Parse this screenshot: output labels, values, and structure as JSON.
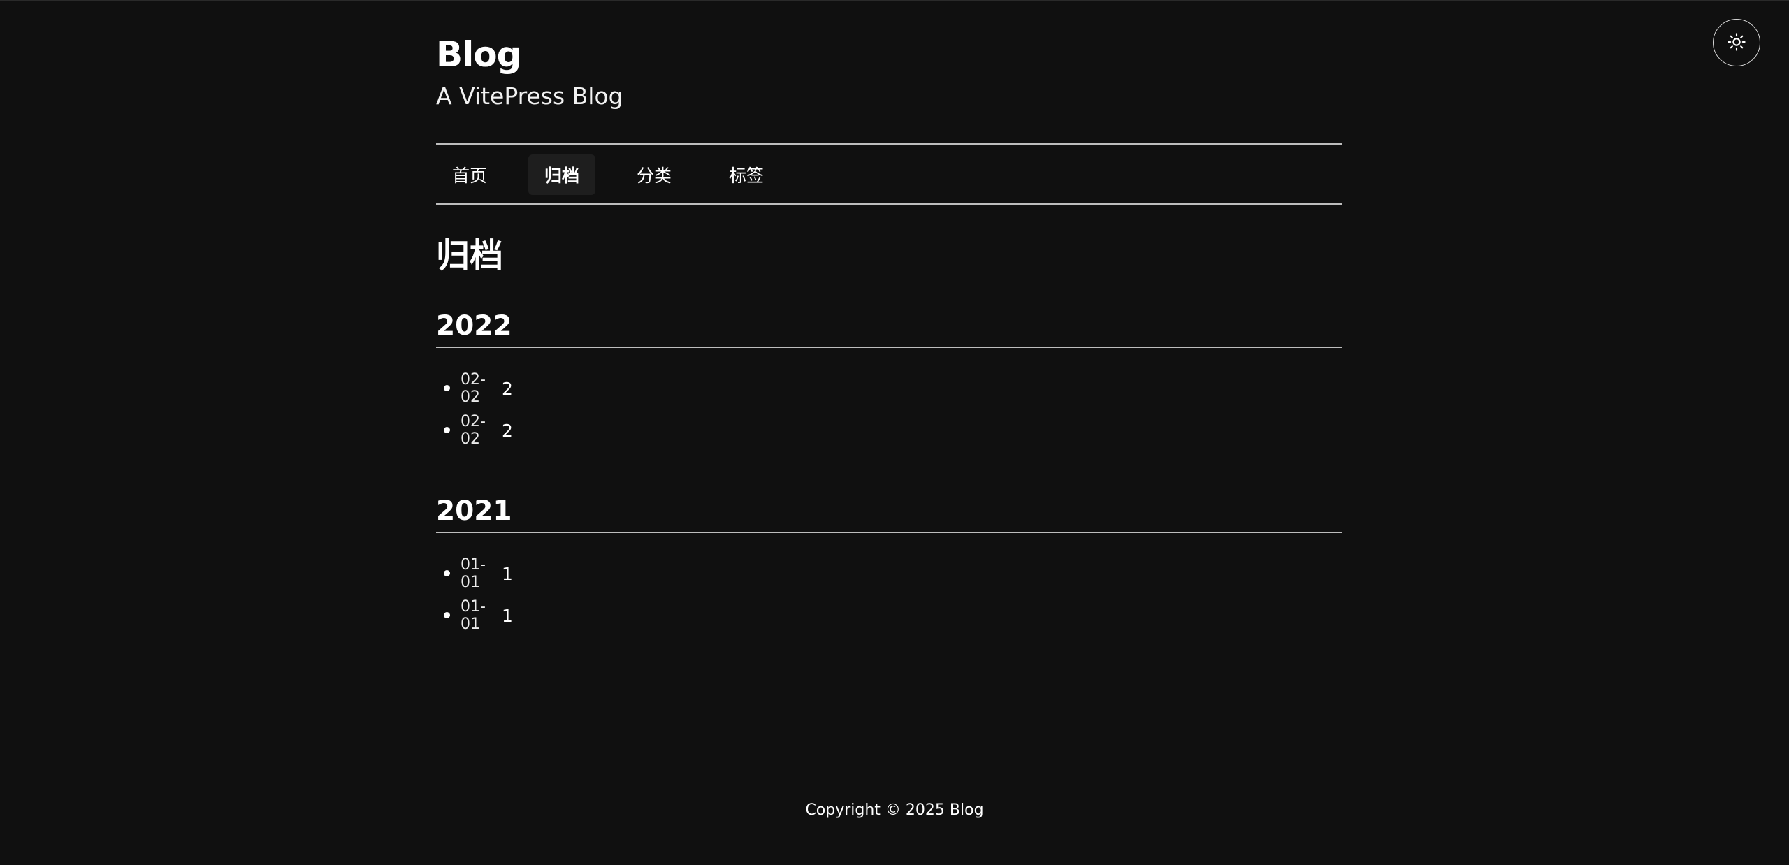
{
  "site": {
    "title": "Blog",
    "subtitle": "A VitePress Blog"
  },
  "theme_toggle": {
    "icon": "sun-icon"
  },
  "nav": {
    "items": [
      {
        "label": "首页",
        "active": false
      },
      {
        "label": "归档",
        "active": true
      },
      {
        "label": "分类",
        "active": false
      },
      {
        "label": "标签",
        "active": false
      }
    ]
  },
  "page": {
    "heading": "归档"
  },
  "archive": [
    {
      "year": "2022",
      "posts": [
        {
          "date": "02-02",
          "title": "2"
        },
        {
          "date": "02-02",
          "title": "2"
        }
      ]
    },
    {
      "year": "2021",
      "posts": [
        {
          "date": "01-01",
          "title": "1"
        },
        {
          "date": "01-01",
          "title": "1"
        }
      ]
    }
  ],
  "footer": {
    "copyright": "Copyright © 2025 Blog"
  },
  "colors": {
    "background": "#101010",
    "text": "#ffffff",
    "divider": "#bdbdbd",
    "active_nav_bg": "#1e1e1e"
  }
}
